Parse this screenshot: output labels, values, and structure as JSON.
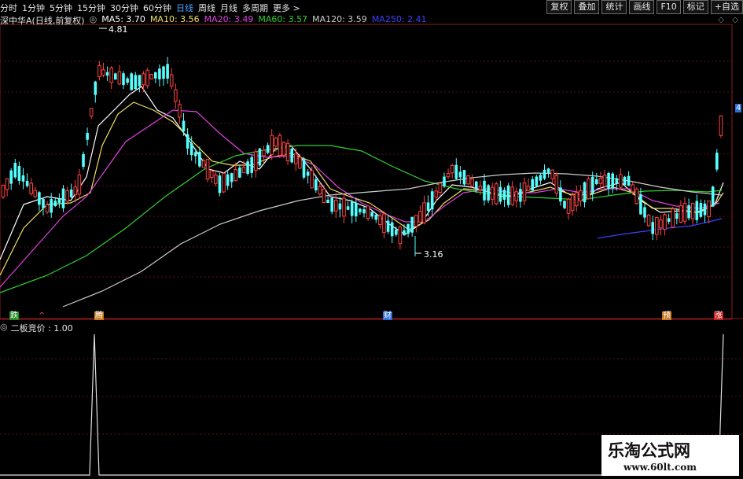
{
  "toolbar": {
    "tabs": [
      "分时",
      "1分钟",
      "5分钟",
      "15分钟",
      "30分钟",
      "60分钟",
      "日线",
      "周线",
      "月线",
      "多周期",
      "更多 >"
    ],
    "active_tab": 6,
    "buttons": [
      "复权",
      "叠加",
      "统计",
      "画线",
      "F10",
      "标记",
      "+自选"
    ]
  },
  "chart_header": {
    "title": "深中华A(日线,前复权)",
    "ma": [
      {
        "label": "MA5: 3.70",
        "color": "#ffffff"
      },
      {
        "label": "MA10: 3.56",
        "color": "#f0e060"
      },
      {
        "label": "MA20: 3.49",
        "color": "#e040e0"
      },
      {
        "label": "MA60: 3.57",
        "color": "#30d030"
      },
      {
        "label": "MA120: 3.59",
        "color": "#cccccc"
      },
      {
        "label": "MA250: 2.41",
        "color": "#3f3fff"
      }
    ]
  },
  "annotations": {
    "high": "4.81",
    "low": "3.16",
    "right_price": "4"
  },
  "markers": [
    {
      "text": "跌",
      "bg": "#1f8a1f",
      "color": "#ffffff"
    },
    {
      "text": "^",
      "bg": "transparent",
      "color": "#ff5050"
    },
    {
      "text": "腾",
      "bg": "#c8781e",
      "color": "#ffffff"
    },
    {
      "text": "财",
      "bg": "#2d6fd8",
      "color": "#ffffff"
    },
    {
      "text": "预",
      "bg": "#c8781e",
      "color": "#ffffff"
    },
    {
      "text": "涨",
      "bg": "#c81e1e",
      "color": "#ffffff"
    }
  ],
  "indicator": {
    "label": "二板竞价 : 1.00"
  },
  "watermark": {
    "title": "乐淘公式网",
    "url": "www.60lt.com"
  },
  "colors": {
    "up": "#ff4040",
    "down": "#54ffff",
    "grid": "#8b1a1a",
    "indicator_line": "#e0e0e0"
  }
}
